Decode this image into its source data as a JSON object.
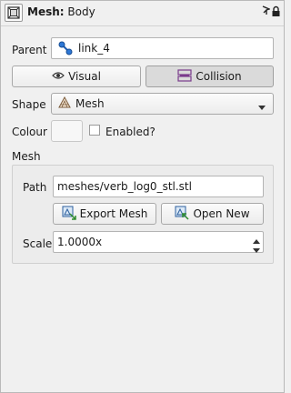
{
  "title": {
    "prefix": "Mesh:",
    "name": "Body"
  },
  "parent": {
    "label": "Parent",
    "value": "link_4"
  },
  "tabs": {
    "visual": "Visual",
    "collision": "Collision"
  },
  "shape": {
    "label": "Shape",
    "value": "Mesh"
  },
  "colour": {
    "label": "Colour",
    "enabled_label": "Enabled?",
    "enabled": false
  },
  "mesh": {
    "section_label": "Mesh",
    "path_label": "Path",
    "path_value": "meshes/verb_log0_stl.stl",
    "export_label": "Export Mesh",
    "open_label": "Open New",
    "scale_label": "Scale",
    "scale_value": "1.0000x"
  },
  "icons": {
    "title": "mesh-frame-icon",
    "pin": "pin-icon",
    "lock": "lock-icon",
    "parent": "link-icon",
    "visual": "eye-icon",
    "collision": "collision-icon",
    "shape": "mesh-shape-icon",
    "export": "export-mesh-icon",
    "open": "open-new-icon"
  }
}
